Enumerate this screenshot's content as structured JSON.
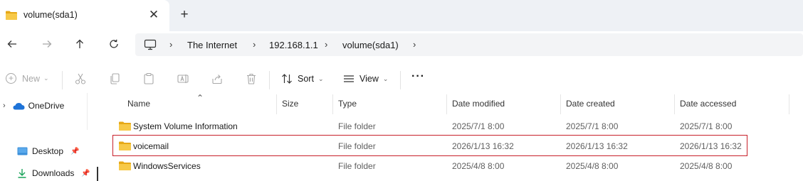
{
  "tab": {
    "title": "volume(sda1)",
    "close_glyph": "✕",
    "new_tab_glyph": "+"
  },
  "address": {
    "crumbs": [
      "The Internet",
      "192.168.1.1",
      "volume(sda1)"
    ],
    "separator": "›"
  },
  "toolbar": {
    "new_label": "New",
    "sort_label": "Sort",
    "view_label": "View",
    "more_label": "···"
  },
  "navpane": {
    "items": [
      {
        "label": "OneDrive",
        "icon": "cloud-icon"
      },
      {
        "label": "Desktop",
        "icon": "desktop-icon"
      },
      {
        "label": "Downloads",
        "icon": "download-icon"
      }
    ]
  },
  "columns": {
    "name": "Name",
    "size": "Size",
    "type": "Type",
    "modified": "Date modified",
    "created": "Date created",
    "accessed": "Date accessed"
  },
  "files": [
    {
      "name": "System Volume Information",
      "size": "",
      "type": "File folder",
      "modified": "2025/7/1 8:00",
      "created": "2025/7/1 8:00",
      "accessed": "2025/7/1 8:00"
    },
    {
      "name": "voicemail",
      "size": "",
      "type": "File folder",
      "modified": "2026/1/13 16:32",
      "created": "2026/1/13 16:32",
      "accessed": "2026/1/13 16:32"
    },
    {
      "name": "WindowsServices",
      "size": "",
      "type": "File folder",
      "modified": "2025/4/8 8:00",
      "created": "2025/4/8 8:00",
      "accessed": "2025/4/8 8:00"
    }
  ],
  "colors": {
    "folder": "#f7c948",
    "folder_dark": "#e6a817",
    "highlight": "#c8202a",
    "tabstrip": "#eef1f5"
  }
}
